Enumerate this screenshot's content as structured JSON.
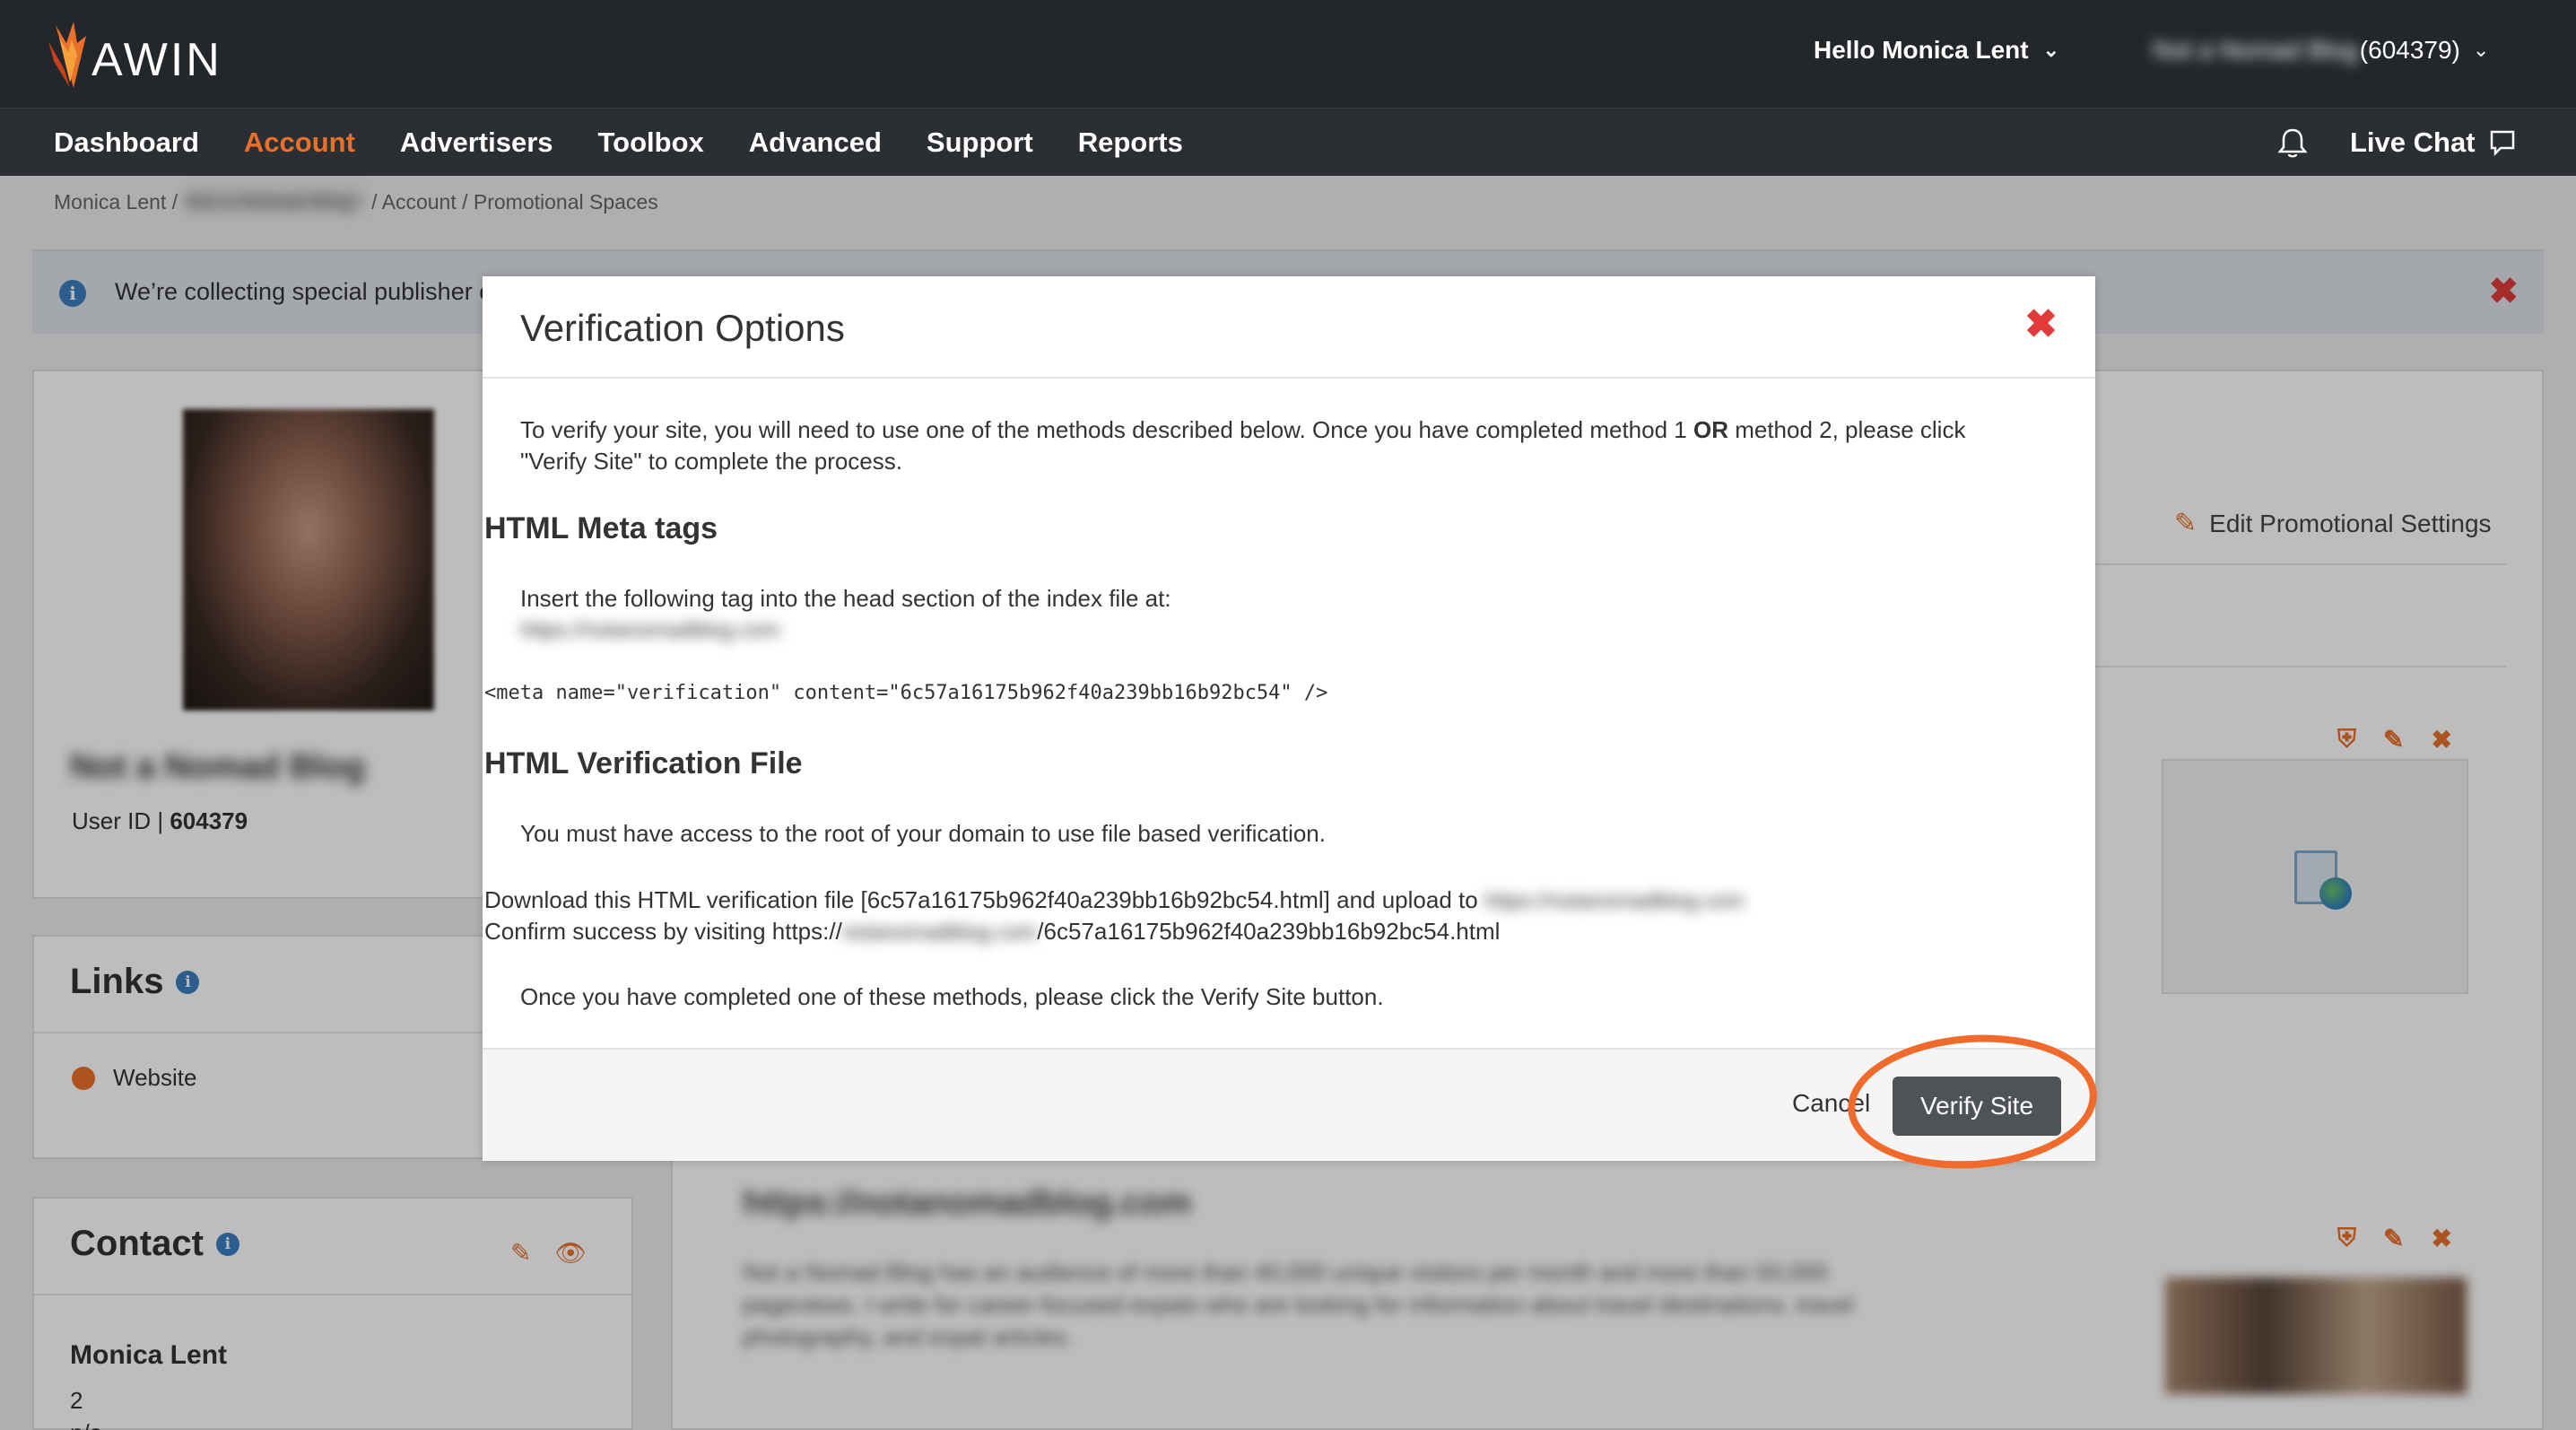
{
  "header": {
    "logo_text": "AWIN",
    "greeting": "Hello Monica Lent",
    "account_name": "Not a Nomad Blog",
    "account_id": "(604379)"
  },
  "nav": {
    "items": [
      "Dashboard",
      "Account",
      "Advertisers",
      "Toolbox",
      "Advanced",
      "Support",
      "Reports"
    ],
    "active": "Account",
    "live_chat": "Live Chat"
  },
  "breadcrumb": {
    "user": "Monica Lent /",
    "account": "Not a Nomad Blog",
    "section": "/ Account / Promotional Spaces"
  },
  "banner": {
    "text": "We’re collecting special publisher c"
  },
  "profile": {
    "name": "Not a Nomad Blog",
    "user_id_label": "User ID |",
    "user_id": "604379"
  },
  "links": {
    "title": "Links",
    "website_label": "Website"
  },
  "contact": {
    "title": "Contact",
    "name": "Monica Lent",
    "line1": "2",
    "line2": "n/a"
  },
  "promo": {
    "edit_label": "Edit Promotional Settings",
    "site_url": "https://notanomadblog.com",
    "site_description": "Not a Nomad Blog has an audience of more than 40,000 unique visitors per month and more than 50,000 pageviews. I write for career-focused expats who are looking for information about travel destinations, travel photography, and expat articles."
  },
  "modal": {
    "title": "Verification Options",
    "intro_1": "To verify your site, you will need to use one of the methods described below. Once you have completed method 1 ",
    "intro_or": "OR",
    "intro_2": " method 2, please click",
    "intro_3": "\"Verify Site\" to complete the process.",
    "meta_heading": "HTML Meta tags",
    "meta_instruction": "Insert the following tag into the head section of the index file at:",
    "meta_url": "https://notanomadblog.com",
    "meta_tag": "<meta name=\"verification\" content=\"6c57a16175b962f40a239bb16b92bc54\" />",
    "file_heading": "HTML Verification File",
    "file_instruction": "You must have access to the root of your domain to use file based verification.",
    "download_prefix": "Download this HTML verification file [6c57a16175b962f40a239bb16b92bc54.html] and upload to",
    "download_url": "https://notanomadblog.com",
    "confirm_prefix": "Confirm success by visiting https://",
    "confirm_domain": "notanomadblog.com",
    "confirm_suffix": "/6c57a16175b962f40a239bb16b92bc54.html",
    "closing": "Once you have completed one of these methods, please click the Verify Site button.",
    "cancel_label": "Cancel",
    "verify_label": "Verify Site"
  },
  "colors": {
    "brand_orange": "#e8702a",
    "header_dark": "#23272b",
    "close_red": "#e03a3a",
    "highlight_ring": "#f06a2b",
    "verify_button": "#4f5358"
  }
}
